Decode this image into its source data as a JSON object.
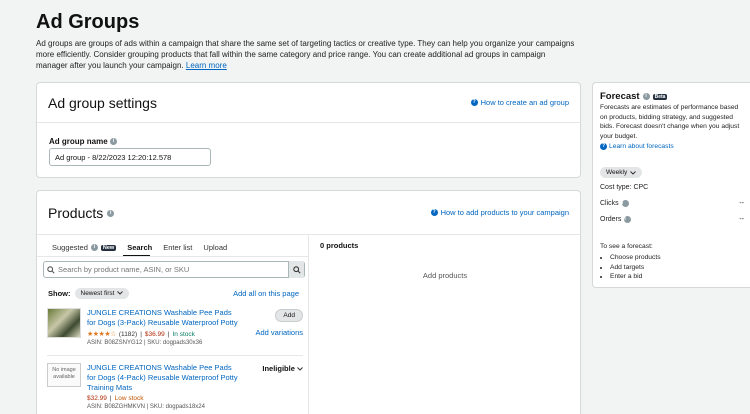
{
  "page": {
    "title": "Ad Groups",
    "intro": "Ad groups are groups of ads within a campaign that share the same set of targeting tactics or creative type. They can help you organize your campaigns more efficiently. Consider grouping products that fall within the same category and price range. You can create additional ad groups in campaign manager after you launch your campaign.",
    "learn_more": "Learn more"
  },
  "settings": {
    "title": "Ad group settings",
    "help_link": "How to create an ad group",
    "name_label": "Ad group name",
    "name_value": "Ad group - 8/22/2023 12:20:12.578"
  },
  "products": {
    "title": "Products",
    "help_link": "How to add products to your campaign",
    "tabs": [
      {
        "label": "Suggested",
        "badge": "New"
      },
      {
        "label": "Search"
      },
      {
        "label": "Enter list"
      },
      {
        "label": "Upload"
      }
    ],
    "search_placeholder": "Search by product name, ASIN, or SKU",
    "show_label": "Show:",
    "sort_value": "Newest first",
    "add_all": "Add all on this page",
    "items": [
      {
        "title": "JUNGLE CREATIONS Washable Pee Pads for Dogs (3-Pack) Reusable Waterproof Potty",
        "stars": "★★★★☆",
        "reviews": "(1182)",
        "price": "$36.99",
        "stock": "In stock",
        "asin": "ASIN: B08ZSNYG12",
        "sku": "SKU: dogpads30x36",
        "add_label": "Add",
        "variations": "Add variations"
      },
      {
        "title": "JUNGLE CREATIONS Washable Pee Pads for Dogs (4-Pack) Reusable Waterproof Potty Training Mats",
        "no_image": "No image available",
        "price": "$32.99",
        "stock": "Low stock",
        "asin": "ASIN: B08ZGHMKVN",
        "sku": "SKU: dogpads18x24",
        "status": "Ineligible"
      }
    ],
    "count_label": "0 products",
    "empty_label": "Add products"
  },
  "forecast": {
    "title": "Forecast",
    "badge": "Beta",
    "description": "Forecasts are estimates of performance based on products, bidding strategy, and suggested bids. Forecast doesn't change when you adjust your budget.",
    "learn_link": "Learn about forecasts",
    "period": "Weekly",
    "cost_type": "Cost type: CPC",
    "clicks_label": "Clicks",
    "clicks_value": "--",
    "orders_label": "Orders",
    "orders_value": "--",
    "steps_title": "To see a forecast:",
    "steps": [
      "Choose products",
      "Add targets",
      "Enter a bid"
    ]
  },
  "colors": {
    "link": "#0066c0",
    "price": "#b12704",
    "in_stock": "#067d62",
    "low_stock": "#c45500",
    "star": "#de7921"
  }
}
